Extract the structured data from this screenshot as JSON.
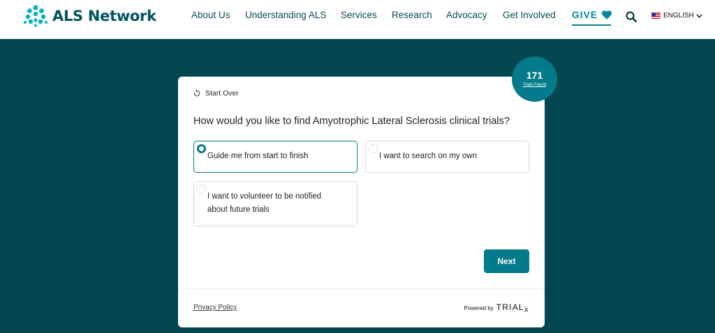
{
  "header": {
    "logo_text": "ALS Network",
    "nav": [
      {
        "label": "About Us"
      },
      {
        "label": "Understanding ALS"
      },
      {
        "label": "Services"
      },
      {
        "label": "Research"
      },
      {
        "label": "Advocacy"
      },
      {
        "label": "Get Involved"
      }
    ],
    "give_label": "GIVE",
    "language": "ENGLISH",
    "icons": {
      "search": "search-icon",
      "give": "heart-icon",
      "language": "us-flag-icon",
      "chevron": "chevron-down-icon"
    }
  },
  "card": {
    "start_over": "Start Over",
    "question": "How would you like to find Amyotrophic Lateral Sclerosis clinical trials?",
    "options": [
      {
        "label": "Guide me from start to finish",
        "selected": true
      },
      {
        "label": "I want to search on my own",
        "selected": false
      },
      {
        "label_line1": "I want to volunteer to be notified",
        "label_line2": "about future trials",
        "selected": false
      }
    ],
    "next_label": "Next",
    "privacy_label": "Privacy Policy",
    "powered_by": "Powered by",
    "powered_brand": "TRIAL",
    "powered_brand_suffix": "X"
  },
  "badge": {
    "count": "171",
    "label": "Trials Found"
  },
  "colors": {
    "page_bg": "#024652",
    "accent": "#047b8a",
    "brand_text": "#03535f",
    "logo": "#00b3c6"
  }
}
